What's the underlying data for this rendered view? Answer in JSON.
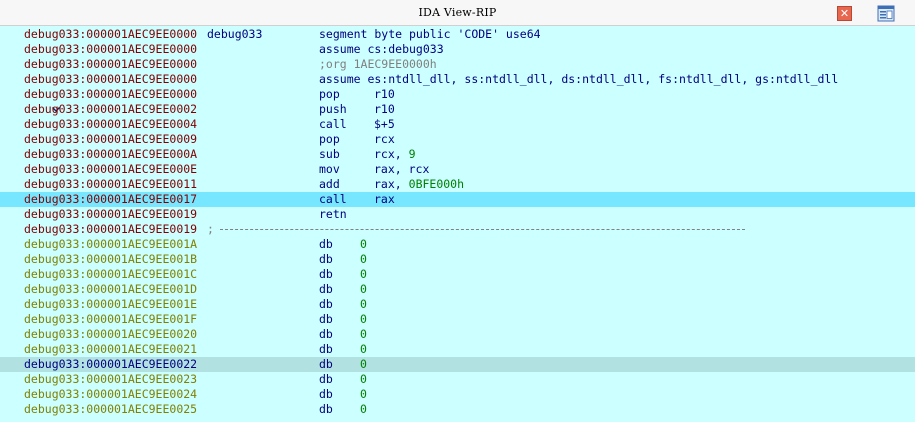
{
  "window": {
    "title": "IDA View-RIP",
    "close_label": "✕"
  },
  "colors": {
    "background": "#ccffff",
    "current_line": "#77e7ff",
    "selected_line": "#b2e1e1",
    "code_address": "#800000",
    "data_address": "#808000",
    "instruction": "#000080",
    "number": "#008000",
    "comment": "#808080"
  },
  "lines": [
    {
      "addr": "debug033:000001AEC9EE0000",
      "label": "debug033",
      "text": "segment byte public 'CODE' use64"
    },
    {
      "addr": "debug033:000001AEC9EE0000",
      "text": "assume cs:debug033"
    },
    {
      "addr": "debug033:000001AEC9EE0000",
      "comment": ";org 1AEC9EE0000h"
    },
    {
      "addr": "debug033:000001AEC9EE0000",
      "text": "assume es:ntdll_dll, ss:ntdll_dll, ds:ntdll_dll, fs:ntdll_dll, gs:ntdll_dll"
    },
    {
      "addr": "debug033:000001AEC9EE0000",
      "mnem": "pop",
      "op": "r10"
    },
    {
      "addr": "debug033:000001AEC9EE0002",
      "mnem": "push",
      "op": "r10"
    },
    {
      "addr": "debug033:000001AEC9EE0004",
      "mnem": "call",
      "op": "$+5"
    },
    {
      "addr": "debug033:000001AEC9EE0009",
      "mnem": "pop",
      "op": "rcx"
    },
    {
      "addr": "debug033:000001AEC9EE000A",
      "mnem": "sub",
      "op": "rcx,",
      "num": "9"
    },
    {
      "addr": "debug033:000001AEC9EE000E",
      "mnem": "mov",
      "op": "rax, rcx"
    },
    {
      "addr": "debug033:000001AEC9EE0011",
      "mnem": "add",
      "op": "rax,",
      "num": "0BFE000h"
    },
    {
      "addr": "debug033:000001AEC9EE0017",
      "mnem": "call",
      "op": "rax"
    },
    {
      "addr": "debug033:000001AEC9EE0019",
      "mnem": "retn",
      "op": ""
    },
    {
      "addr": "debug033:000001AEC9EE0019",
      "separator": ";"
    },
    {
      "addr": "debug033:000001AEC9EE001A",
      "mnem": "db",
      "num": "0"
    },
    {
      "addr": "debug033:000001AEC9EE001B",
      "mnem": "db",
      "num": "0"
    },
    {
      "addr": "debug033:000001AEC9EE001C",
      "mnem": "db",
      "num": "0"
    },
    {
      "addr": "debug033:000001AEC9EE001D",
      "mnem": "db",
      "num": "0"
    },
    {
      "addr": "debug033:000001AEC9EE001E",
      "mnem": "db",
      "num": "0"
    },
    {
      "addr": "debug033:000001AEC9EE001F",
      "mnem": "db",
      "num": "0"
    },
    {
      "addr": "debug033:000001AEC9EE0020",
      "mnem": "db",
      "num": "0"
    },
    {
      "addr": "debug033:000001AEC9EE0021",
      "mnem": "db",
      "num": "0"
    },
    {
      "addr": "debug033:000001AEC9EE0022",
      "mnem": "db",
      "num": "0"
    },
    {
      "addr": "debug033:000001AEC9EE0023",
      "mnem": "db",
      "num": "0"
    },
    {
      "addr": "debug033:000001AEC9EE0024",
      "mnem": "db",
      "num": "0"
    },
    {
      "addr": "debug033:000001AEC9EE0025",
      "mnem": "db",
      "num": "0"
    }
  ]
}
